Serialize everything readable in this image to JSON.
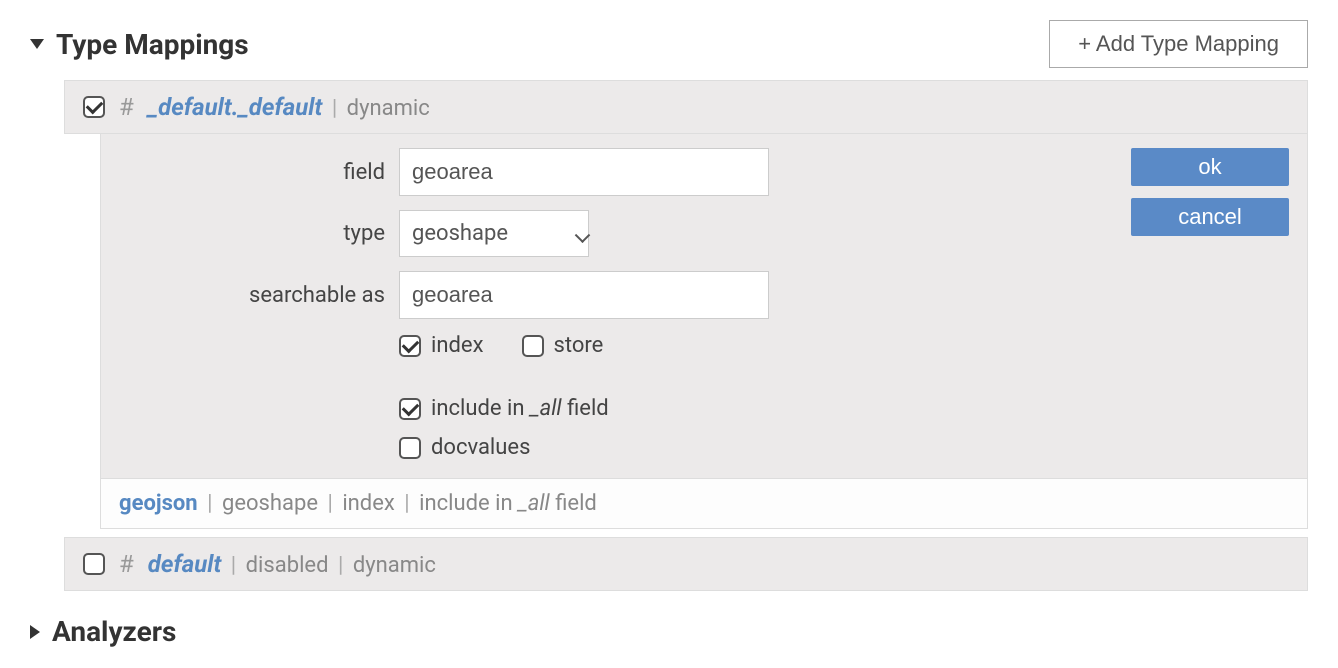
{
  "sections": {
    "typeMappings": {
      "title": "Type Mappings",
      "addButton": "+ Add Type Mapping"
    },
    "analyzers": {
      "title": "Analyzers"
    }
  },
  "mappings": [
    {
      "hash": "#",
      "name": "_default._default",
      "tag": "dynamic",
      "enabled": true,
      "editor": {
        "labels": {
          "field": "field",
          "type": "type",
          "searchableAs": "searchable as"
        },
        "fieldValue": "geoarea",
        "typeValue": "geoshape",
        "searchableAsValue": "geoarea",
        "checkboxes": {
          "index": {
            "label": "index",
            "checked": true
          },
          "store": {
            "label": "store",
            "checked": false
          },
          "includeInAll": {
            "prefix": "include in",
            "italic": "_all",
            "suffix": "field",
            "checked": true
          },
          "docvalues": {
            "label": "docvalues",
            "checked": false
          }
        },
        "buttons": {
          "ok": "ok",
          "cancel": "cancel"
        }
      },
      "fieldSummary": {
        "name": "geojson",
        "tags": [
          "geoshape",
          "index"
        ],
        "includeInAll": {
          "prefix": "include in",
          "italic": "_all",
          "suffix": "field"
        }
      }
    },
    {
      "hash": "#",
      "name": "default",
      "tags": [
        "disabled",
        "dynamic"
      ],
      "enabled": false
    }
  ]
}
